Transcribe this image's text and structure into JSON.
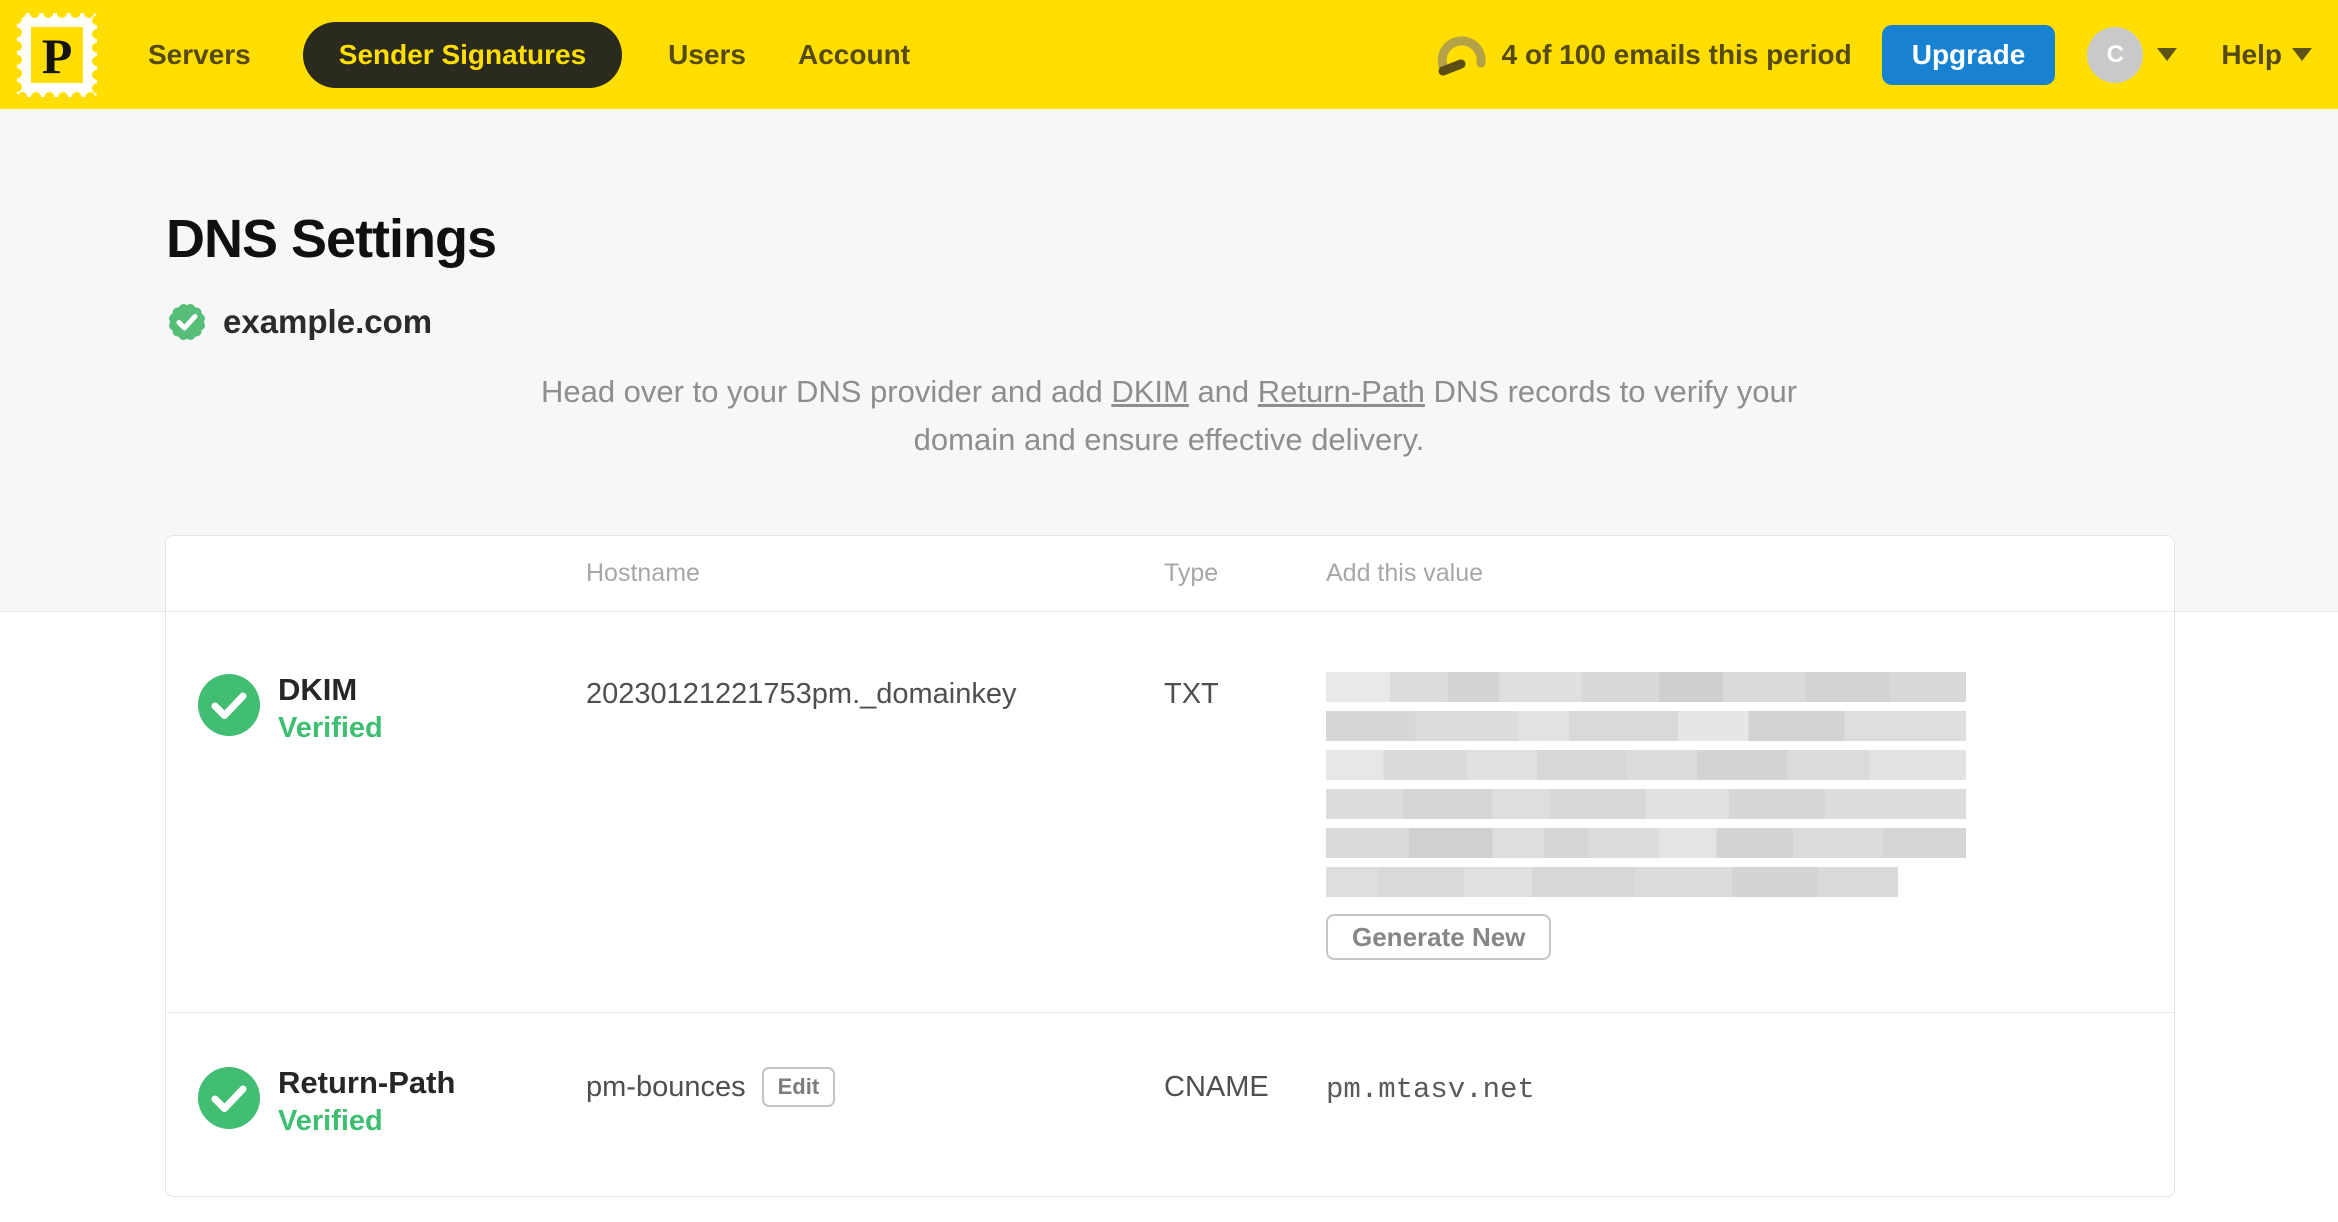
{
  "colors": {
    "brand_yellow": "#FFDE00",
    "nav_text": "#564a14",
    "active_pill_bg": "#2a2a1e",
    "upgrade_blue": "#1782D2",
    "verified_green": "#3EBE71",
    "link_gray": "#8e8e8e"
  },
  "navbar": {
    "brand_letter": "P",
    "items": [
      {
        "label": "Servers",
        "active": false
      },
      {
        "label": "Sender Signatures",
        "active": true
      },
      {
        "label": "Users",
        "active": false
      },
      {
        "label": "Account",
        "active": false
      }
    ],
    "usage_text": "4 of 100 emails this period",
    "upgrade_label": "Upgrade",
    "avatar_initial": "C",
    "help_label": "Help"
  },
  "page": {
    "title": "DNS Settings",
    "domain": "example.com",
    "intro": {
      "text_before": "Head over to your DNS provider and add ",
      "link_dkim": "DKIM",
      "text_mid": " and ",
      "link_return_path": "Return-Path",
      "text_after": " DNS records to verify your domain and ensure effective delivery."
    }
  },
  "table": {
    "headers": {
      "hostname": "Hostname",
      "type": "Type",
      "value": "Add this value"
    },
    "dkim": {
      "name": "DKIM",
      "status": "Verified",
      "hostname": "20230121221753pm._domainkey",
      "type": "TXT",
      "action_label": "Generate New"
    },
    "return_path": {
      "name": "Return-Path",
      "status": "Verified",
      "hostname": "pm-bounces",
      "edit_label": "Edit",
      "type": "CNAME",
      "value": "pm.mtasv.net"
    }
  }
}
